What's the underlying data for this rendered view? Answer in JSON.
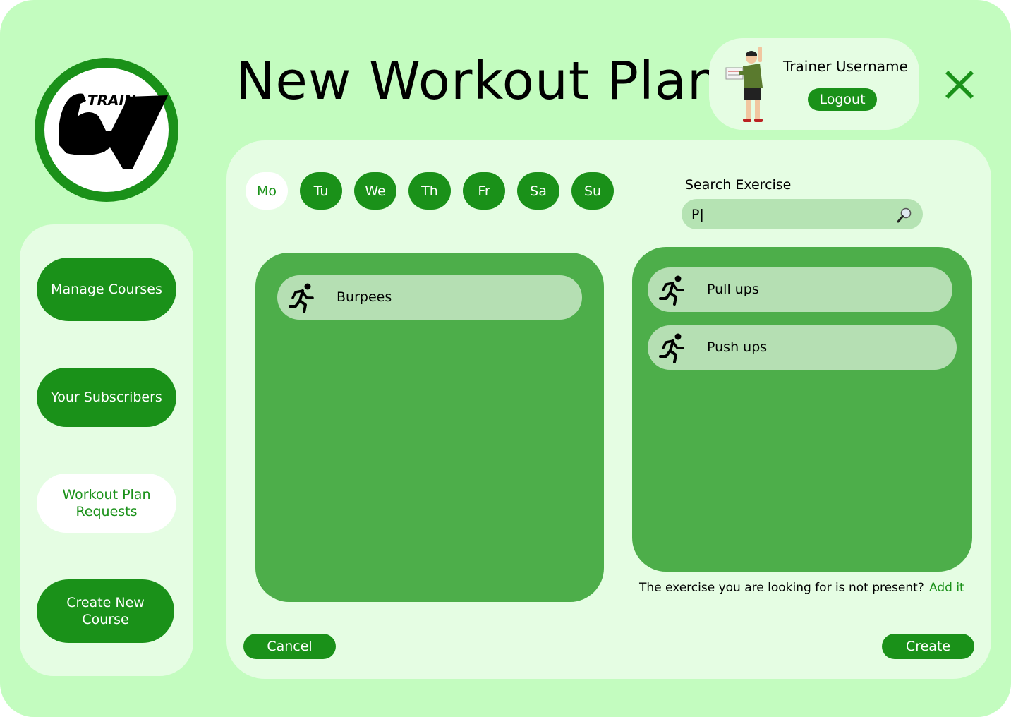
{
  "header": {
    "title": "New Workout Plan",
    "logo_text": "TRAIN"
  },
  "user": {
    "username": "Trainer Username",
    "logout_label": "Logout"
  },
  "sidebar": {
    "items": [
      {
        "label": "Manage Courses",
        "active": false
      },
      {
        "label": "Your Subscribers",
        "active": false
      },
      {
        "label": "Workout Plan Requests",
        "active": true
      },
      {
        "label": "Create New Course",
        "active": false
      }
    ]
  },
  "days": [
    {
      "label": "Mo",
      "active": true
    },
    {
      "label": "Tu",
      "active": false
    },
    {
      "label": "We",
      "active": false
    },
    {
      "label": "Th",
      "active": false
    },
    {
      "label": "Fr",
      "active": false
    },
    {
      "label": "Sa",
      "active": false
    },
    {
      "label": "Su",
      "active": false
    }
  ],
  "search": {
    "label": "Search Exercise",
    "value": "P|"
  },
  "plan": {
    "exercises": [
      {
        "name": "Burpees",
        "icon": "running-icon"
      }
    ]
  },
  "results": {
    "exercises": [
      {
        "name": "Pull ups",
        "icon": "running-icon"
      },
      {
        "name": "Push ups",
        "icon": "running-icon"
      }
    ]
  },
  "footer": {
    "not_present_text": "The exercise you are looking for is not present?",
    "add_link": "Add it",
    "cancel_label": "Cancel",
    "create_label": "Create"
  },
  "colors": {
    "background": "#c3fcbf",
    "panel": "#e5fde3",
    "primary": "#1a9119",
    "list_panel": "#4dae4a",
    "list_item": "#b5dfb3"
  }
}
